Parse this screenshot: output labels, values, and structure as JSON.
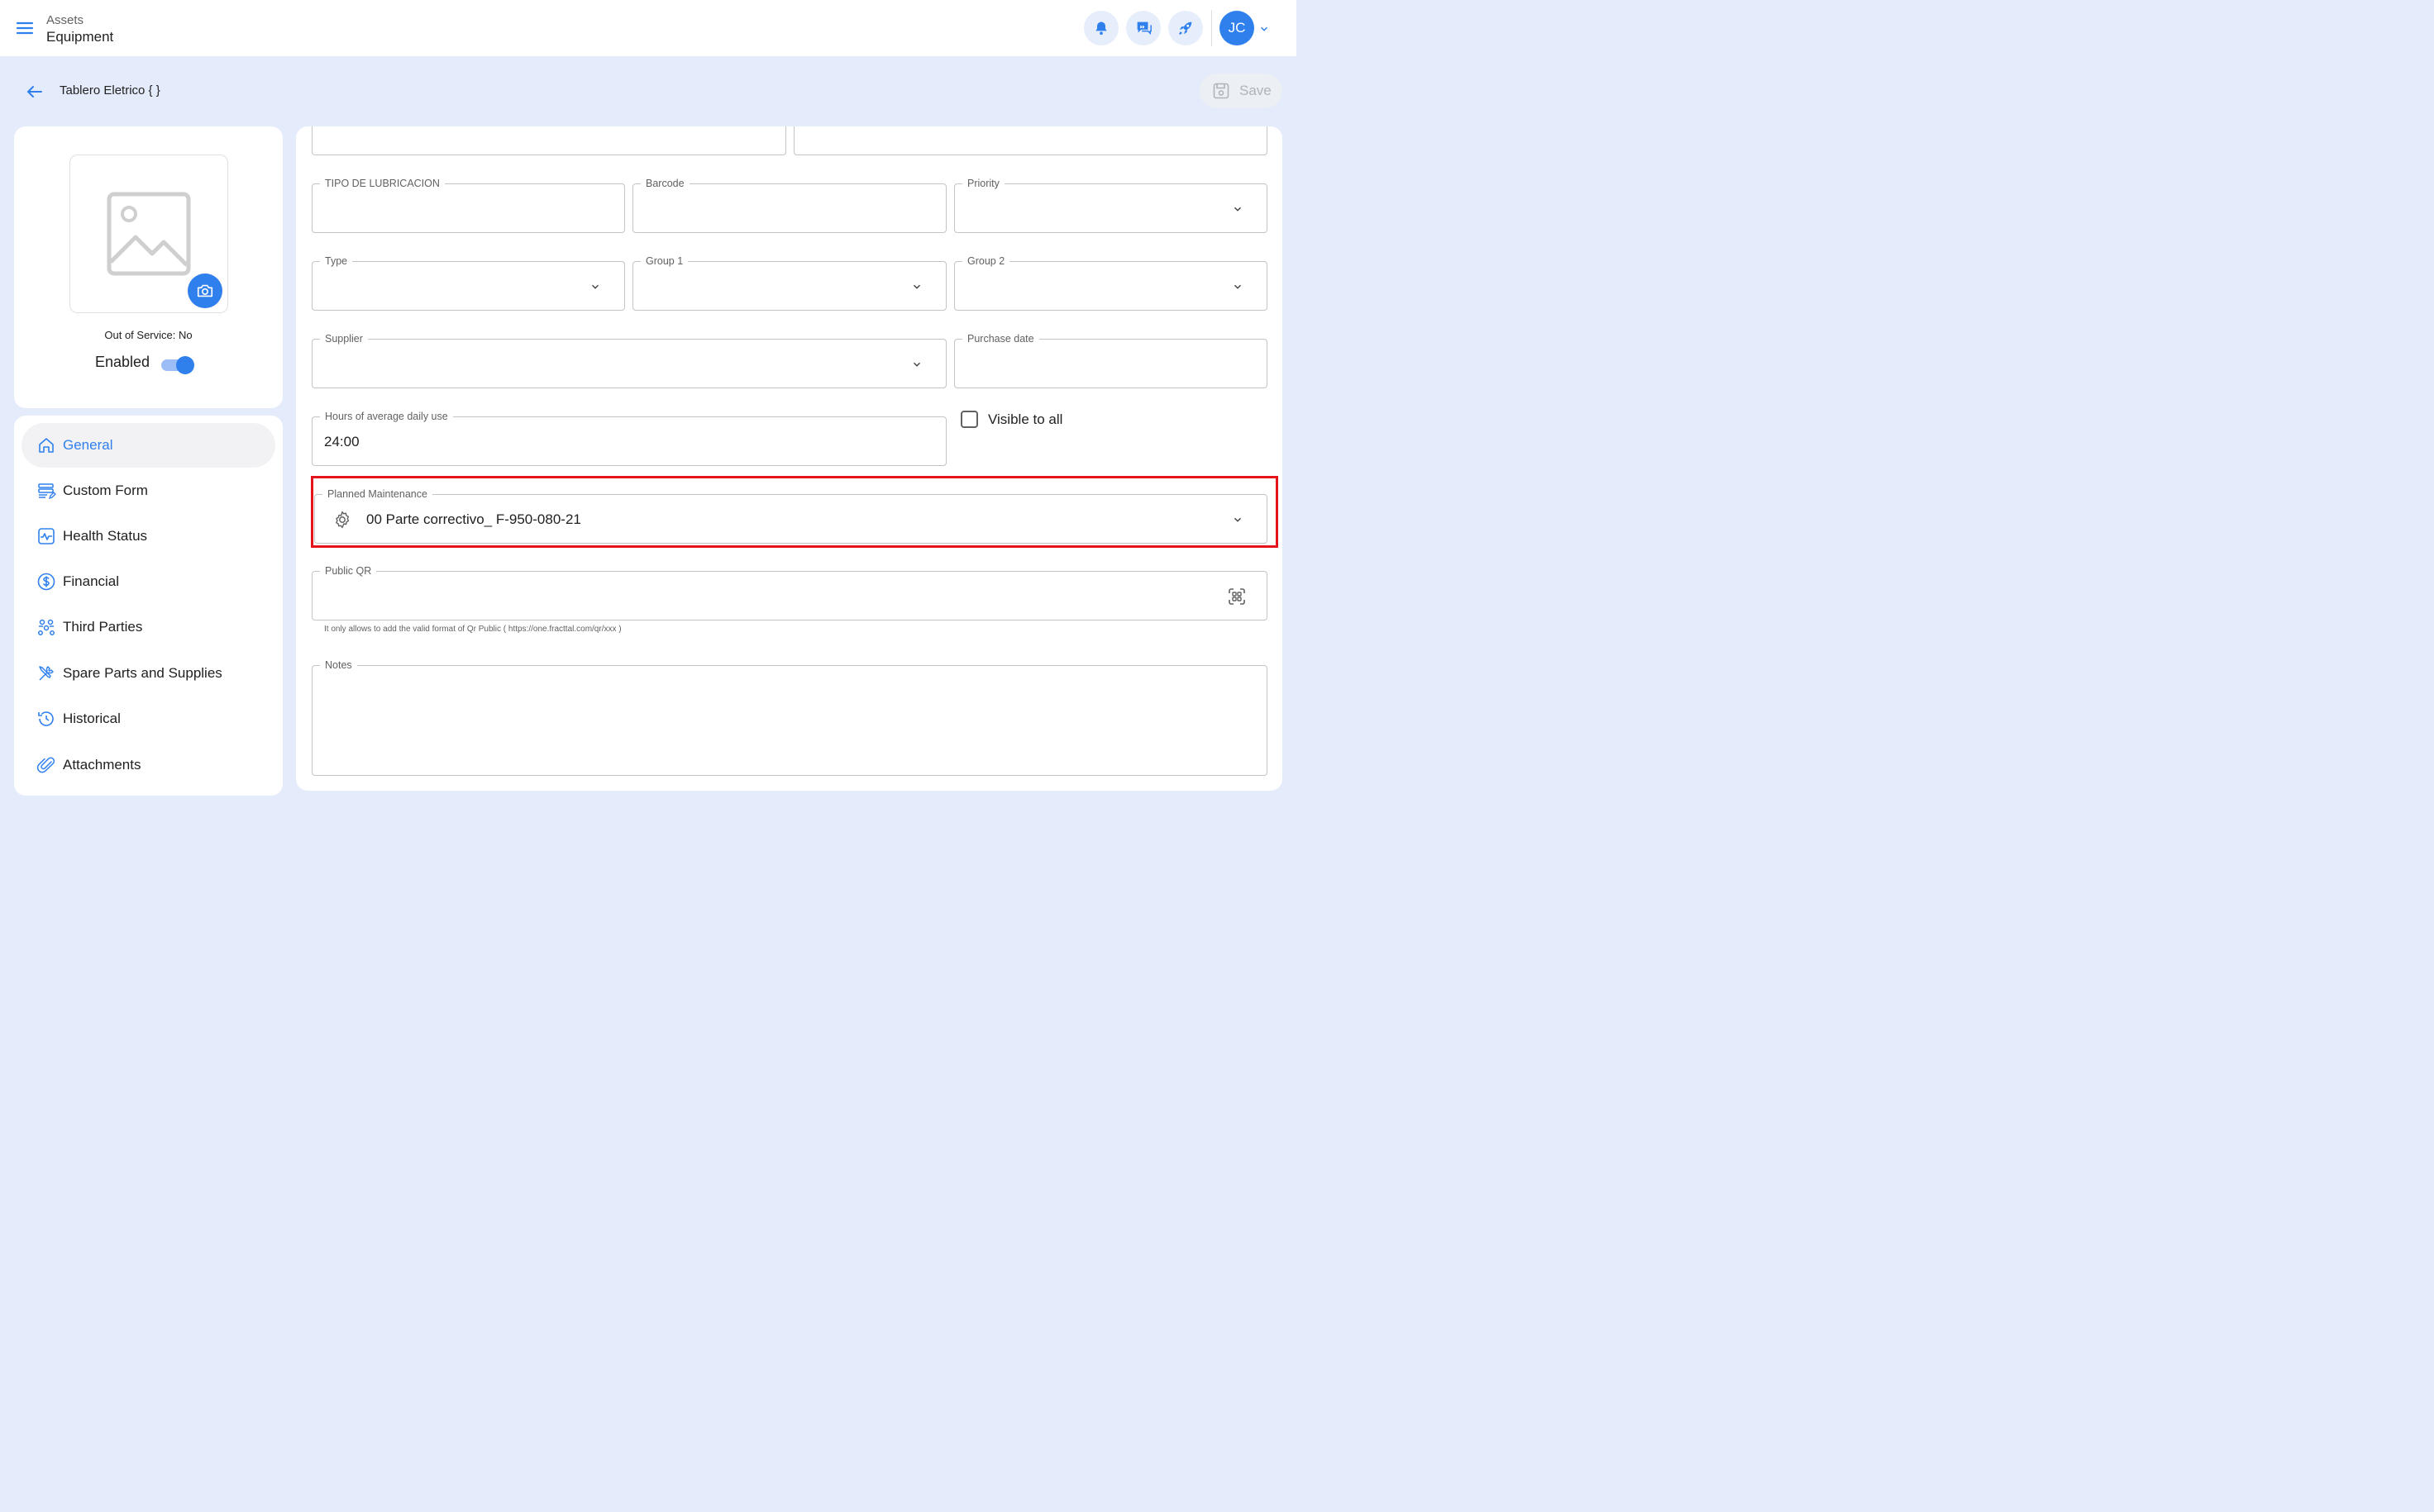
{
  "header": {
    "breadcrumb_parent": "Assets",
    "breadcrumb_current": "Equipment",
    "avatar_initials": "JC",
    "icons": [
      "menu-icon",
      "bell-icon",
      "chat-icon",
      "rocket-icon",
      "chevron-down-icon"
    ]
  },
  "page": {
    "title": "Tablero Eletrico { }",
    "save_label": "Save"
  },
  "asset_card": {
    "out_of_service": "Out of Service: No",
    "enabled_label": "Enabled",
    "enabled": true
  },
  "nav": {
    "items": [
      {
        "label": "General",
        "icon": "home-icon",
        "active": true
      },
      {
        "label": "Custom Form",
        "icon": "form-icon",
        "active": false
      },
      {
        "label": "Health Status",
        "icon": "health-icon",
        "active": false
      },
      {
        "label": "Financial",
        "icon": "dollar-icon",
        "active": false
      },
      {
        "label": "Third Parties",
        "icon": "people-icon",
        "active": false
      },
      {
        "label": "Spare Parts and Supplies",
        "icon": "tools-icon",
        "active": false
      },
      {
        "label": "Historical",
        "icon": "history-icon",
        "active": false
      },
      {
        "label": "Attachments",
        "icon": "paperclip-icon",
        "active": false
      }
    ]
  },
  "form": {
    "tipo_lubricacion": {
      "label": "TIPO DE LUBRICACION",
      "value": ""
    },
    "barcode": {
      "label": "Barcode",
      "value": ""
    },
    "priority": {
      "label": "Priority",
      "value": ""
    },
    "type": {
      "label": "Type",
      "value": ""
    },
    "group1": {
      "label": "Group 1",
      "value": ""
    },
    "group2": {
      "label": "Group 2",
      "value": ""
    },
    "supplier": {
      "label": "Supplier",
      "value": ""
    },
    "purchase_date": {
      "label": "Purchase date",
      "value": ""
    },
    "hours_daily_use": {
      "label": "Hours of average daily use",
      "value": "24:00"
    },
    "visible_to_all": {
      "label": "Visible to all",
      "checked": false
    },
    "planned_maintenance": {
      "label": "Planned Maintenance",
      "value": "00 Parte correctivo_ F-950-080-21"
    },
    "public_qr": {
      "label": "Public QR",
      "value": "",
      "helper": "It only allows to add the valid format of Qr Public ( https://one.fracttal.com/qr/xxx )"
    },
    "notes": {
      "label": "Notes",
      "value": ""
    }
  },
  "colors": {
    "accent": "#2f80ed",
    "page_bg": "#e4ecfb",
    "highlight": "#e5141b"
  }
}
